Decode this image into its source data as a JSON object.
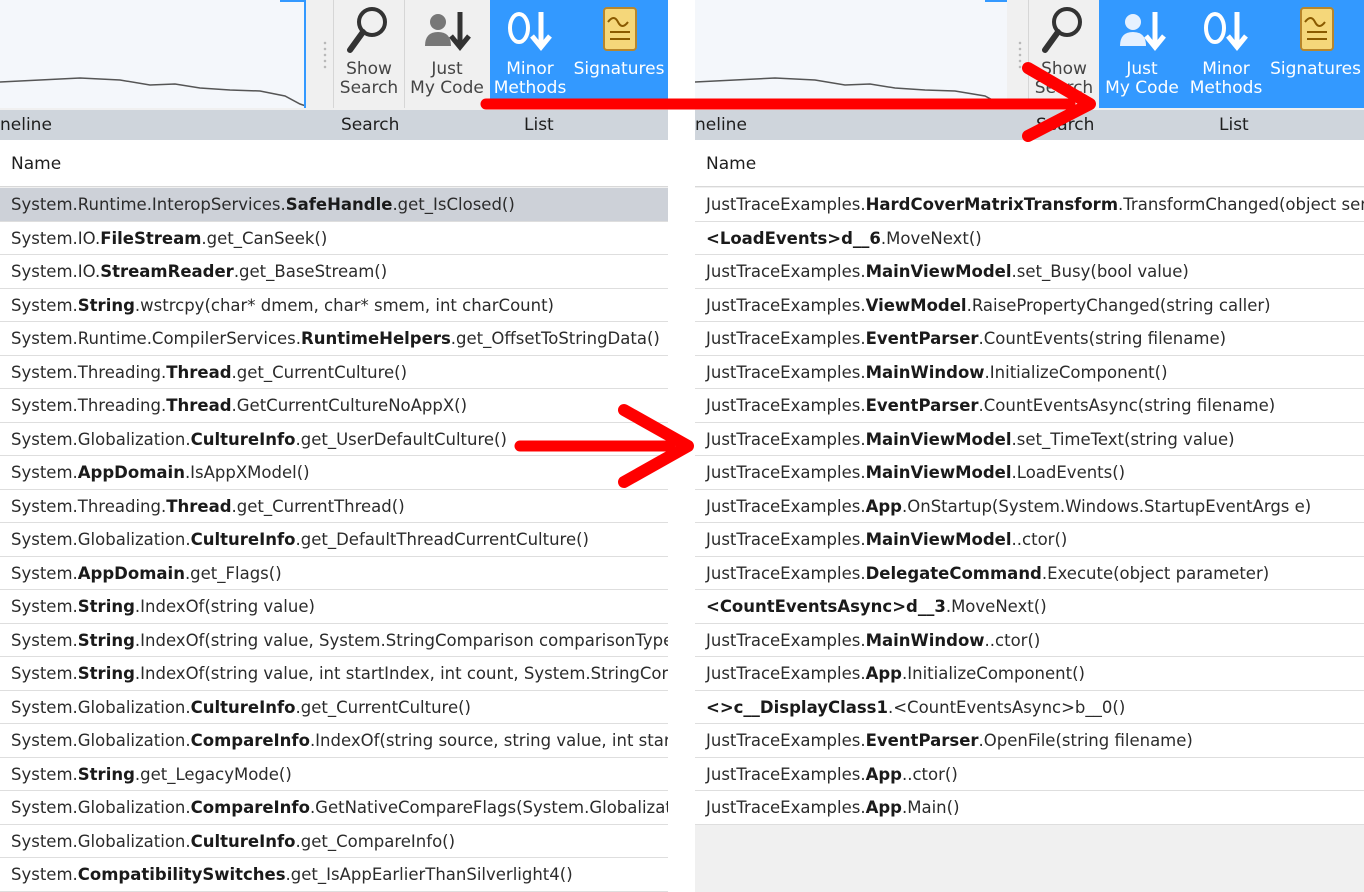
{
  "left": {
    "toolbar": [
      {
        "id": "show-search",
        "label": "Show\nSearch",
        "icon": "magnifier-icon",
        "active": false
      },
      {
        "id": "just-my-code",
        "label": "Just\nMy Code",
        "icon": "user-arrow-icon",
        "active": false
      },
      {
        "id": "minor-methods",
        "label": "Minor\nMethods",
        "icon": "zero-arrow-icon",
        "active": true
      },
      {
        "id": "signatures",
        "label": "Signatures",
        "icon": "signature-scroll-icon",
        "active": true
      }
    ],
    "groups": {
      "timeline": "neline",
      "search": "Search",
      "list": "List"
    },
    "column_header": "Name",
    "rows": [
      {
        "pre": "System.Runtime.InteropServices.",
        "bold": "SafeHandle",
        "post": ".get_IsClosed()",
        "selected": true
      },
      {
        "pre": "System.IO.",
        "bold": "FileStream",
        "post": ".get_CanSeek()"
      },
      {
        "pre": "System.IO.",
        "bold": "StreamReader",
        "post": ".get_BaseStream()"
      },
      {
        "pre": "System.",
        "bold": "String",
        "post": ".wstrcpy(char* dmem, char* smem, int charCount)"
      },
      {
        "pre": "System.Runtime.CompilerServices.",
        "bold": "RuntimeHelpers",
        "post": ".get_OffsetToStringData()"
      },
      {
        "pre": "System.Threading.",
        "bold": "Thread",
        "post": ".get_CurrentCulture()"
      },
      {
        "pre": "System.Threading.",
        "bold": "Thread",
        "post": ".GetCurrentCultureNoAppX()"
      },
      {
        "pre": "System.Globalization.",
        "bold": "CultureInfo",
        "post": ".get_UserDefaultCulture()"
      },
      {
        "pre": "System.",
        "bold": "AppDomain",
        "post": ".IsAppXModel()"
      },
      {
        "pre": "System.Threading.",
        "bold": "Thread",
        "post": ".get_CurrentThread()"
      },
      {
        "pre": "System.Globalization.",
        "bold": "CultureInfo",
        "post": ".get_DefaultThreadCurrentCulture()"
      },
      {
        "pre": "System.",
        "bold": "AppDomain",
        "post": ".get_Flags()"
      },
      {
        "pre": "System.",
        "bold": "String",
        "post": ".IndexOf(string value)"
      },
      {
        "pre": "System.",
        "bold": "String",
        "post": ".IndexOf(string value, System.StringComparison comparisonType)"
      },
      {
        "pre": "System.",
        "bold": "String",
        "post": ".IndexOf(string value, int startIndex, int count, System.StringComp"
      },
      {
        "pre": "System.Globalization.",
        "bold": "CultureInfo",
        "post": ".get_CurrentCulture()"
      },
      {
        "pre": "System.Globalization.",
        "bold": "CompareInfo",
        "post": ".IndexOf(string source, string value, int startI"
      },
      {
        "pre": "System.",
        "bold": "String",
        "post": ".get_LegacyMode()"
      },
      {
        "pre": "System.Globalization.",
        "bold": "CompareInfo",
        "post": ".GetNativeCompareFlags(System.Globalizatio"
      },
      {
        "pre": "System.Globalization.",
        "bold": "CultureInfo",
        "post": ".get_CompareInfo()"
      },
      {
        "pre": "System.",
        "bold": "CompatibilitySwitches",
        "post": ".get_IsAppEarlierThanSilverlight4()"
      }
    ]
  },
  "right": {
    "toolbar": [
      {
        "id": "show-search",
        "label": "Show\nSearch",
        "icon": "magnifier-icon",
        "active": false
      },
      {
        "id": "just-my-code",
        "label": "Just\nMy Code",
        "icon": "user-arrow-icon",
        "active": true
      },
      {
        "id": "minor-methods",
        "label": "Minor\nMethods",
        "icon": "zero-arrow-icon",
        "active": true
      },
      {
        "id": "signatures",
        "label": "Signatures",
        "icon": "signature-scroll-icon",
        "active": true
      }
    ],
    "groups": {
      "timeline": "neline",
      "search": "Search",
      "list": "List"
    },
    "column_header": "Name",
    "rows": [
      {
        "pre": "JustTraceExamples.",
        "bold": "HardCoverMatrixTransform",
        "post": ".TransformChanged(object sende"
      },
      {
        "pre": "",
        "bold": "<LoadEvents>d__6",
        "post": ".MoveNext()"
      },
      {
        "pre": "JustTraceExamples.",
        "bold": "MainViewModel",
        "post": ".set_Busy(bool value)"
      },
      {
        "pre": "JustTraceExamples.",
        "bold": "ViewModel",
        "post": ".RaisePropertyChanged(string caller)"
      },
      {
        "pre": "JustTraceExamples.",
        "bold": "EventParser",
        "post": ".CountEvents(string filename)"
      },
      {
        "pre": "JustTraceExamples.",
        "bold": "MainWindow",
        "post": ".InitializeComponent()"
      },
      {
        "pre": "JustTraceExamples.",
        "bold": "EventParser",
        "post": ".CountEventsAsync(string filename)"
      },
      {
        "pre": "JustTraceExamples.",
        "bold": "MainViewModel",
        "post": ".set_TimeText(string value)"
      },
      {
        "pre": "JustTraceExamples.",
        "bold": "MainViewModel",
        "post": ".LoadEvents()"
      },
      {
        "pre": "JustTraceExamples.",
        "bold": "App",
        "post": ".OnStartup(System.Windows.StartupEventArgs e)"
      },
      {
        "pre": "JustTraceExamples.",
        "bold": "MainViewModel",
        "post": "..ctor()"
      },
      {
        "pre": "JustTraceExamples.",
        "bold": "DelegateCommand",
        "post": ".Execute(object parameter)"
      },
      {
        "pre": "",
        "bold": "<CountEventsAsync>d__3",
        "post": ".MoveNext()"
      },
      {
        "pre": "JustTraceExamples.",
        "bold": "MainWindow",
        "post": "..ctor()"
      },
      {
        "pre": "JustTraceExamples.",
        "bold": "App",
        "post": ".InitializeComponent()"
      },
      {
        "pre": "",
        "bold": "<>c__DisplayClass1",
        "post": ".<CountEventsAsync>b__0()"
      },
      {
        "pre": "JustTraceExamples.",
        "bold": "EventParser",
        "post": ".OpenFile(string filename)"
      },
      {
        "pre": "JustTraceExamples.",
        "bold": "App",
        "post": "..ctor()"
      },
      {
        "pre": "JustTraceExamples.",
        "bold": "App",
        "post": ".Main()"
      }
    ]
  },
  "colors": {
    "active_button": "#3399ff",
    "group_bar": "#cfd5dc",
    "selected_row": "#cdd1d8",
    "arrow": "#ff0000"
  }
}
